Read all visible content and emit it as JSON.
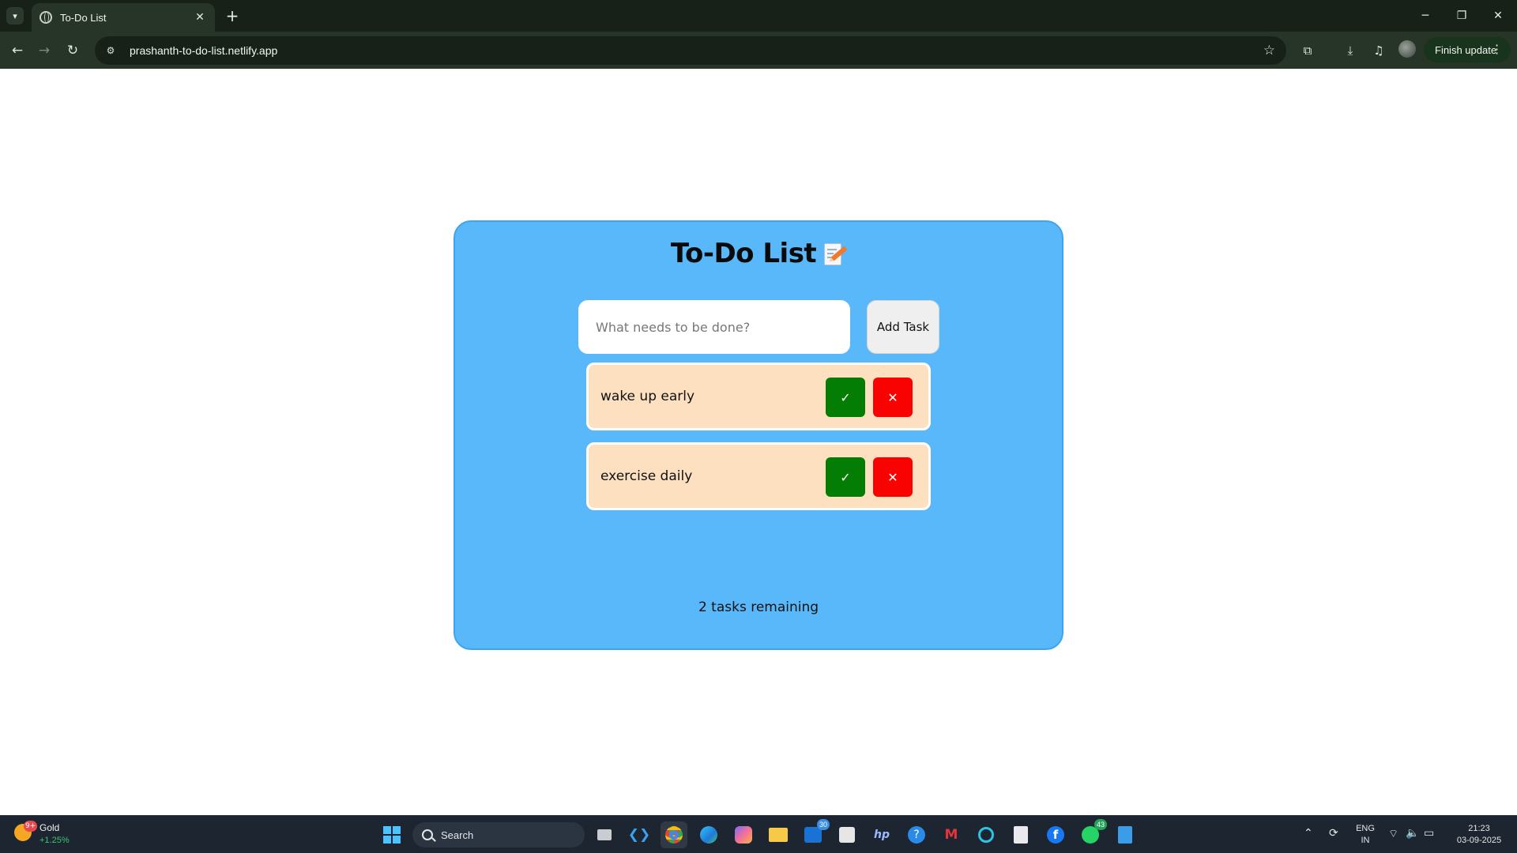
{
  "browser": {
    "tab_title": "To-Do List",
    "tab_close": "✕",
    "new_tab": "+",
    "url": "prashanth-to-do-list.netlify.app",
    "finish_update_label": "Finish update",
    "window_controls": {
      "minimize": "─",
      "maximize": "❐",
      "close": "✕"
    }
  },
  "app": {
    "title": "To-Do List",
    "input_placeholder": "What needs to be done?",
    "add_button_label": "Add Task",
    "tasks": [
      {
        "text": "wake up early",
        "done_symbol": "✓",
        "delete_symbol": "✕"
      },
      {
        "text": "exercise daily",
        "done_symbol": "✓",
        "delete_symbol": "✕"
      }
    ],
    "remaining_text": "2 tasks remaining",
    "colors": {
      "card_background": "#58b8f9",
      "task_background": "#fde0c0",
      "done_button": "#037d03",
      "delete_button": "#f80202"
    }
  },
  "taskbar": {
    "widget": {
      "title": "Gold",
      "change": "+1.25%",
      "badge": "9+"
    },
    "search_label": "Search",
    "badges": {
      "outlook": "30",
      "whatsapp": "43"
    },
    "language": {
      "line1": "ENG",
      "line2": "IN"
    },
    "clock": {
      "time": "21:23",
      "date": "03-09-2025"
    }
  }
}
